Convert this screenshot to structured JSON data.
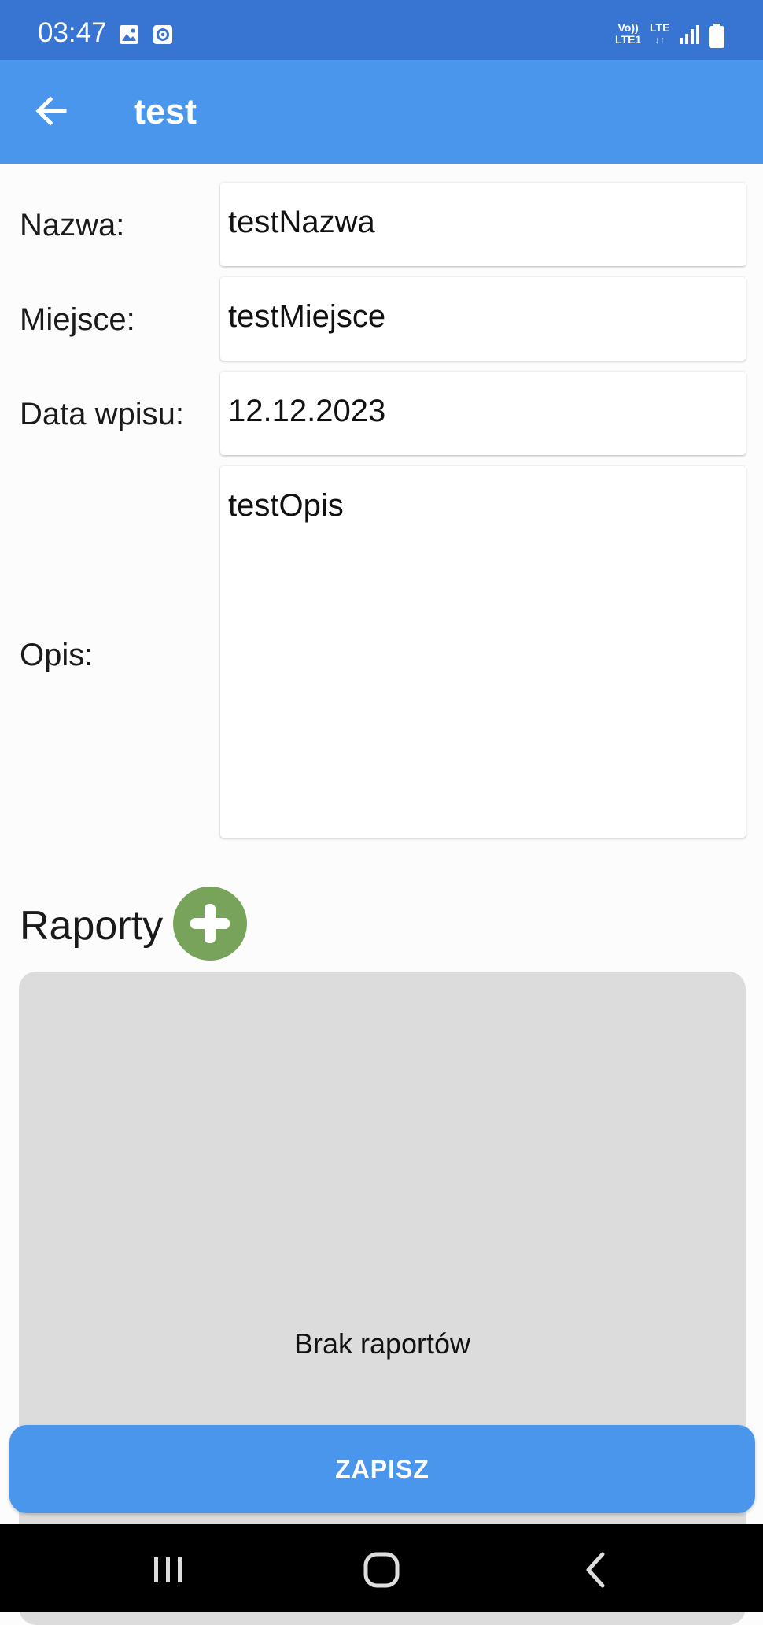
{
  "status_bar": {
    "time": "03:47",
    "volte_line1": "Vo))",
    "volte_line2": "LTE1",
    "lte_label": "LTE",
    "icons": [
      "image-icon",
      "screen-recorder-icon",
      "signal-icon",
      "battery-icon"
    ]
  },
  "app_bar": {
    "title": "test",
    "back_icon": "arrow-back-icon",
    "color": "#4a96ec"
  },
  "form": {
    "name_label": "Nazwa:",
    "name_value": "testNazwa",
    "place_label": "Miejsce:",
    "place_value": "testMiejsce",
    "date_label": "Data wpisu:",
    "date_value": "12.12.2023",
    "description_label": "Opis:",
    "description_value": "testOpis"
  },
  "reports": {
    "title": "Raporty",
    "add_icon": "plus-circle-icon",
    "add_color": "#78a35a",
    "empty_text": "Brak raportów"
  },
  "actions": {
    "save_label": "ZAPISZ"
  },
  "nav_bar": {
    "icons": [
      "recent-apps-icon",
      "home-icon",
      "back-icon"
    ]
  }
}
